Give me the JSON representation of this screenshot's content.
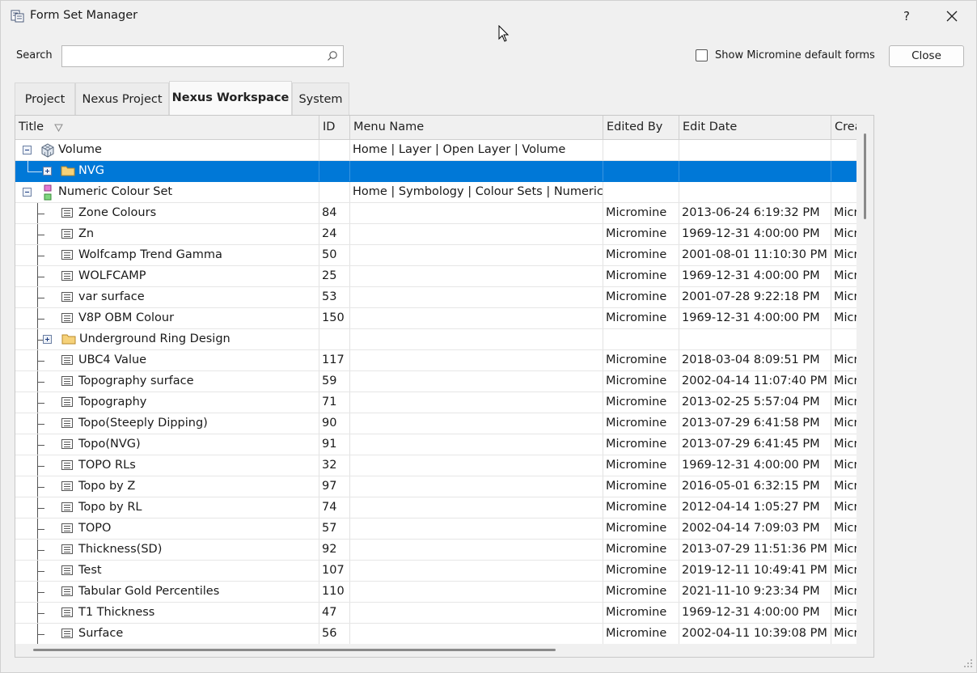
{
  "window": {
    "title": "Form Set Manager",
    "help": "?"
  },
  "search": {
    "label": "Search",
    "value": ""
  },
  "show_default": {
    "label": "Show Micromine default forms",
    "checked": false
  },
  "close_label": "Close",
  "tabs": [
    {
      "label": "Project"
    },
    {
      "label": "Nexus Project"
    },
    {
      "label": "Nexus Workspace",
      "active": true
    },
    {
      "label": "System"
    }
  ],
  "columns": [
    "Title",
    "ID",
    "Menu Name",
    "Edited By",
    "Edit Date",
    "Crea"
  ],
  "rows": [
    {
      "title": "Volume",
      "id": "",
      "menu": "Home | Layer | Open Layer | Volume",
      "edited_by": "",
      "edit_date": "",
      "created": "",
      "kind": "group-volume"
    },
    {
      "title": "NVG",
      "id": "",
      "menu": "",
      "edited_by": "",
      "edit_date": "",
      "created": "",
      "kind": "folder",
      "selected": true
    },
    {
      "title": "Numeric Colour Set",
      "id": "",
      "menu": "Home | Symbology | Colour Sets | Numeric C...",
      "edited_by": "",
      "edit_date": "",
      "created": "",
      "kind": "group-colour"
    },
    {
      "title": "Zone Colours",
      "id": "84",
      "menu": "",
      "edited_by": "Micromine",
      "edit_date": "2013-06-24 6:19:32 PM",
      "created": "Micr",
      "kind": "form"
    },
    {
      "title": "Zn",
      "id": "24",
      "menu": "",
      "edited_by": "Micromine",
      "edit_date": "1969-12-31 4:00:00 PM",
      "created": "Micr",
      "kind": "form"
    },
    {
      "title": "Wolfcamp Trend Gamma",
      "id": "50",
      "menu": "",
      "edited_by": "Micromine",
      "edit_date": "2001-08-01 11:10:30 PM",
      "created": "Micr",
      "kind": "form"
    },
    {
      "title": "WOLFCAMP",
      "id": "25",
      "menu": "",
      "edited_by": "Micromine",
      "edit_date": "1969-12-31 4:00:00 PM",
      "created": "Micr",
      "kind": "form"
    },
    {
      "title": "var surface",
      "id": "53",
      "menu": "",
      "edited_by": "Micromine",
      "edit_date": "2001-07-28 9:22:18 PM",
      "created": "Micr",
      "kind": "form"
    },
    {
      "title": "V8P OBM Colour",
      "id": "150",
      "menu": "",
      "edited_by": "Micromine",
      "edit_date": "1969-12-31 4:00:00 PM",
      "created": "Micr",
      "kind": "form"
    },
    {
      "title": "Underground Ring Design",
      "id": "",
      "menu": "",
      "edited_by": "",
      "edit_date": "",
      "created": "",
      "kind": "subfolder"
    },
    {
      "title": "UBC4 Value",
      "id": "117",
      "menu": "",
      "edited_by": "Micromine",
      "edit_date": "2018-03-04 8:09:51 PM",
      "created": "Micr",
      "kind": "form"
    },
    {
      "title": "Topography surface",
      "id": "59",
      "menu": "",
      "edited_by": "Micromine",
      "edit_date": "2002-04-14 11:07:40 PM",
      "created": "Micr",
      "kind": "form"
    },
    {
      "title": "Topography",
      "id": "71",
      "menu": "",
      "edited_by": "Micromine",
      "edit_date": "2013-02-25 5:57:04 PM",
      "created": "Micr",
      "kind": "form"
    },
    {
      "title": "Topo(Steeply Dipping)",
      "id": "90",
      "menu": "",
      "edited_by": "Micromine",
      "edit_date": "2013-07-29 6:41:58 PM",
      "created": "Micr",
      "kind": "form"
    },
    {
      "title": "Topo(NVG)",
      "id": "91",
      "menu": "",
      "edited_by": "Micromine",
      "edit_date": "2013-07-29 6:41:45 PM",
      "created": "Micr",
      "kind": "form"
    },
    {
      "title": "TOPO RLs",
      "id": "32",
      "menu": "",
      "edited_by": "Micromine",
      "edit_date": "1969-12-31 4:00:00 PM",
      "created": "Micr",
      "kind": "form"
    },
    {
      "title": "Topo by Z",
      "id": "97",
      "menu": "",
      "edited_by": "Micromine",
      "edit_date": "2016-05-01 6:32:15 PM",
      "created": "Micr",
      "kind": "form"
    },
    {
      "title": "Topo by RL",
      "id": "74",
      "menu": "",
      "edited_by": "Micromine",
      "edit_date": "2012-04-14 1:05:27 PM",
      "created": "Micr",
      "kind": "form"
    },
    {
      "title": "TOPO",
      "id": "57",
      "menu": "",
      "edited_by": "Micromine",
      "edit_date": "2002-04-14 7:09:03 PM",
      "created": "Micr",
      "kind": "form"
    },
    {
      "title": "Thickness(SD)",
      "id": "92",
      "menu": "",
      "edited_by": "Micromine",
      "edit_date": "2013-07-29 11:51:36 PM",
      "created": "Micr",
      "kind": "form"
    },
    {
      "title": "Test",
      "id": "107",
      "menu": "",
      "edited_by": "Micromine",
      "edit_date": "2019-12-11 10:49:41 PM",
      "created": "Micr",
      "kind": "form"
    },
    {
      "title": "Tabular Gold Percentiles",
      "id": "110",
      "menu": "",
      "edited_by": "Micromine",
      "edit_date": "2021-11-10 9:23:34 PM",
      "created": "Micr",
      "kind": "form"
    },
    {
      "title": "T1 Thickness",
      "id": "47",
      "menu": "",
      "edited_by": "Micromine",
      "edit_date": "1969-12-31 4:00:00 PM",
      "created": "Micr",
      "kind": "form"
    },
    {
      "title": "Surface",
      "id": "56",
      "menu": "",
      "edited_by": "Micromine",
      "edit_date": "2002-04-11 10:39:08 PM",
      "created": "Micr",
      "kind": "form"
    }
  ]
}
